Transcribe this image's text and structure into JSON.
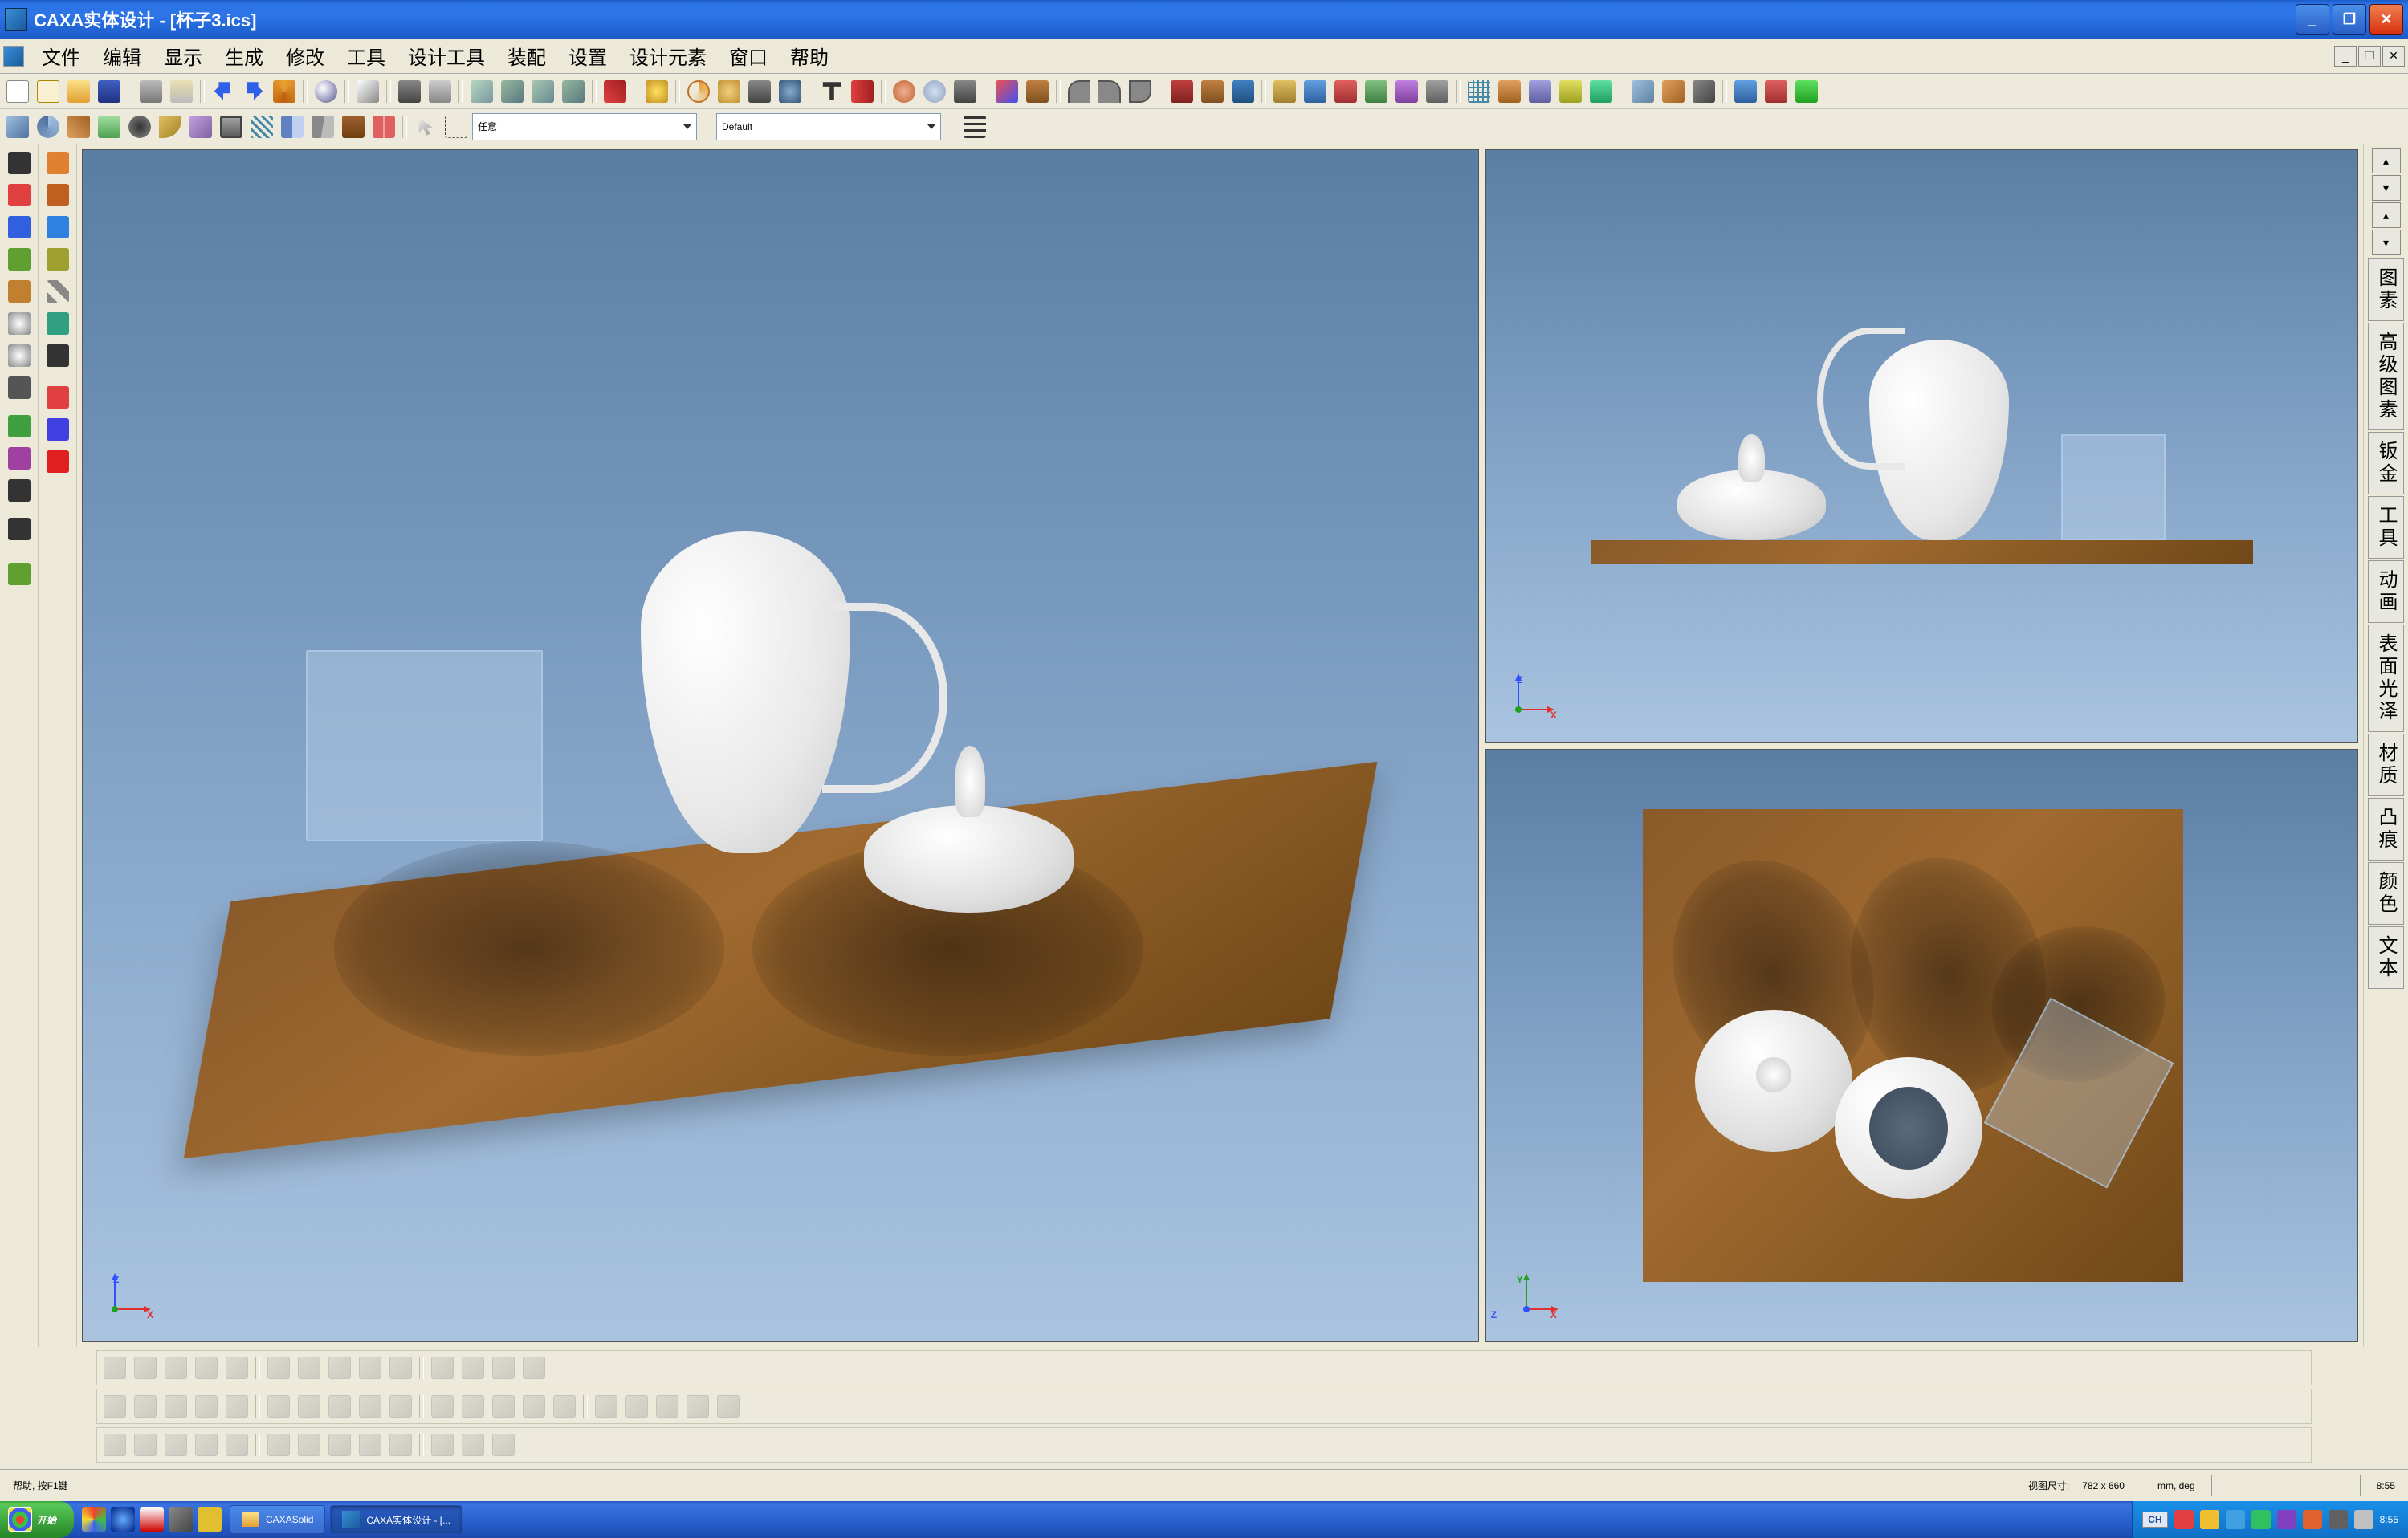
{
  "titlebar": {
    "title": "CAXA实体设计 - [杯子3.ics]"
  },
  "menus": [
    "文件",
    "编辑",
    "显示",
    "生成",
    "修改",
    "工具",
    "设计工具",
    "装配",
    "设置",
    "设计元素",
    "窗口",
    "帮助"
  ],
  "toolbar2": {
    "dropdown1": "任意",
    "dropdown2": "Default"
  },
  "right_tabs": [
    "图素",
    "高级图素",
    "钣金",
    "工具",
    "动画",
    "表面光泽",
    "材质",
    "凸痕",
    "颜色",
    "文本"
  ],
  "viewports": {
    "main_axes": {
      "v": "Z",
      "h": "X"
    },
    "top_right_axes": {
      "v": "Z",
      "h": "X"
    },
    "bottom_right_axes": {
      "v": "Y",
      "h": "X",
      "extra": "Z"
    }
  },
  "statusbar": {
    "help": "帮助, 按F1键",
    "viewsize_label": "视图尺寸:",
    "viewsize_value": "782 x 660",
    "units": "mm, deg",
    "clock": "8:55"
  },
  "taskbar": {
    "start": "开始",
    "tasks": [
      {
        "label": "CAXASolid",
        "active": false
      },
      {
        "label": "CAXA实体设计 - [...",
        "active": true
      }
    ],
    "lang": "CH",
    "time": "8:55"
  },
  "icon_colors": {
    "file_new": "#f0e8c0",
    "open": "#e8c050",
    "save": "#4060c0",
    "print": "#808890",
    "undo": "#3060e8",
    "redo": "#3060e8",
    "run": "#e8a030",
    "search": "#505050",
    "help": "#3060e0",
    "zoom": "#e84040",
    "pan": "#4040e8",
    "rotate": "#40a040",
    "render": "#c83030",
    "tool": "#606060",
    "ball": "#3050a0",
    "measure": "#e07030",
    "cut": "#808080",
    "anchor": "#805030"
  }
}
